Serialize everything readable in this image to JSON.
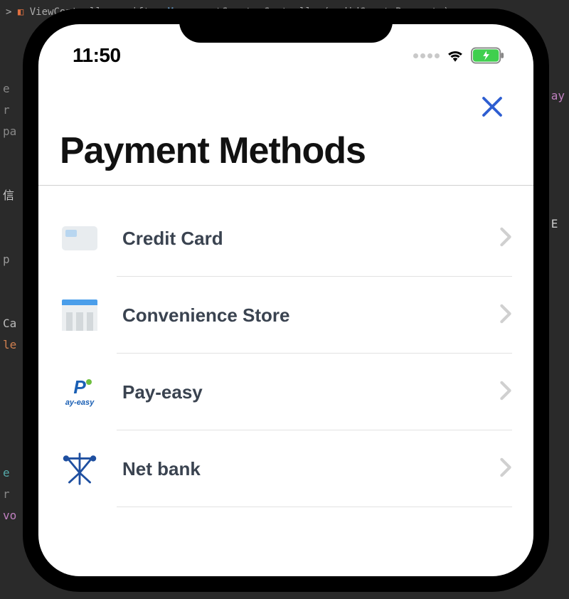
{
  "statusbar": {
    "time": "11:50"
  },
  "navbar": {
    "close_label": "Close"
  },
  "title": "Payment Methods",
  "methods": {
    "0": {
      "label": "Credit Card"
    },
    "1": {
      "label": "Convenience Store"
    },
    "2": {
      "label": "Pay-easy"
    },
    "3": {
      "label": "Net bank"
    }
  },
  "bg": {
    "breadcrumb_file": "ViewController.swift",
    "breadcrumb_func": "paymentCreatorController(_:didCreatePayment:)"
  }
}
